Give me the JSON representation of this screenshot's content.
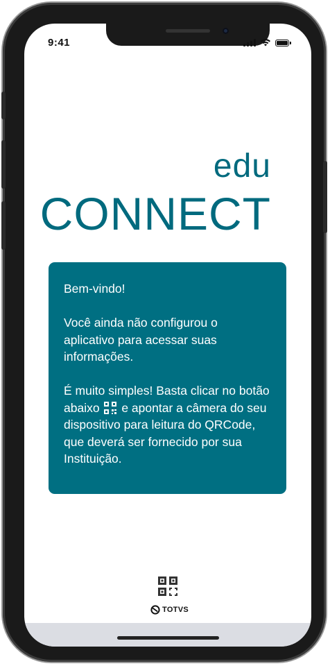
{
  "status_bar": {
    "time": "9:41"
  },
  "logo": {
    "line1": "edu",
    "line2": "CONNECT"
  },
  "card": {
    "greeting": "Bem-vindo!",
    "paragraph1": "Você ainda não configurou o aplicativo para acessar suas informações.",
    "paragraph2_before_icon": "É muito simples! Basta clicar no botão abaixo",
    "paragraph2_after_icon": "e apontar a câmera do seu dispositivo para leitura do QRCode, que deverá ser fornecido por sua Instituição.",
    "background_color": "#006f82",
    "text_color": "#ffffff"
  },
  "bottom": {
    "scan_button_icon": "qr-code-icon",
    "brand_text": "TOTVS",
    "brand_icon": "totvs-logo-icon"
  },
  "colors": {
    "accent": "#006a7e"
  }
}
